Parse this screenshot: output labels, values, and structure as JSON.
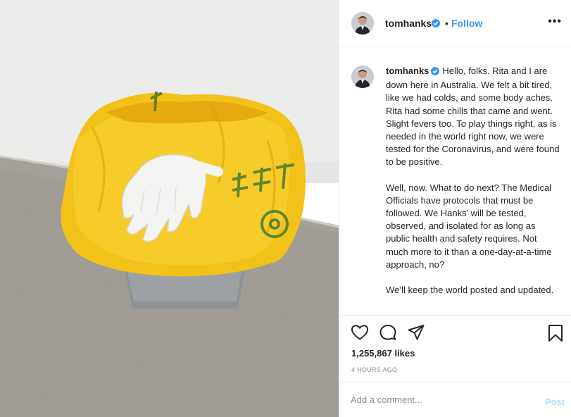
{
  "post": {
    "username": "tomhanks",
    "follow_label": "Follow",
    "separator": "•",
    "more_label": "•••",
    "caption_paragraphs": [
      "Hello, folks. Rita and I are down here in Australia. We felt a bit tired, like we had colds, and some body aches. Rita had some chills that came and went. Slight fevers too. To play things right, as is needed in the world right now, we were tested for the Coronavirus, and were found to be positive.",
      "Well, now. What to do next? The Medical Officials have protocols that must be followed. We Hanks’ will be tested, observed, and isolated for as long as public health and safety requires. Not much more to it than a one-day-at-a-time approach, no?",
      "We’ll keep the world posted and updated."
    ],
    "likes": "1,255,867 likes",
    "time": "4 HOURS AGO",
    "comment_placeholder": "Add a comment...",
    "post_label": "Post"
  },
  "icons": {
    "verified": "verified-badge-icon",
    "like": "heart-icon",
    "comment": "comment-bubble-icon",
    "share": "paper-plane-icon",
    "save": "bookmark-icon"
  },
  "colors": {
    "link_blue": "#3897f0",
    "verified_blue": "#3897f0",
    "muted": "#8e8e8e",
    "post_disabled": "#b2dffc"
  }
}
